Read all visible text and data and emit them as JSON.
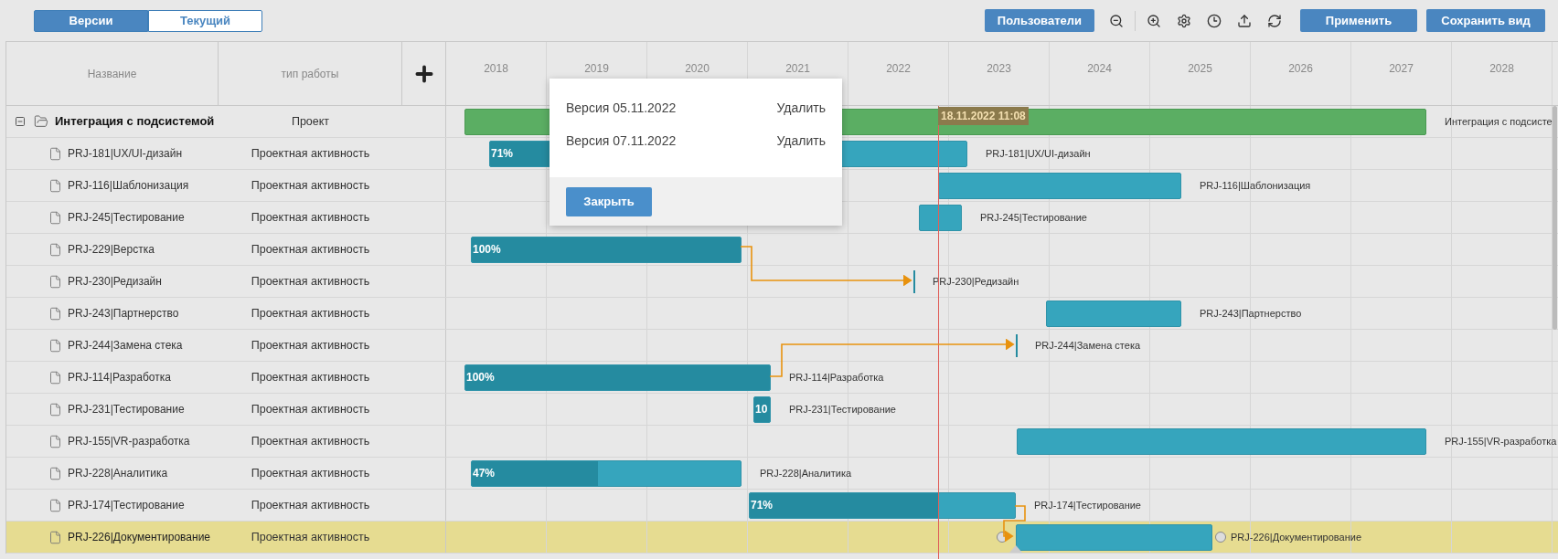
{
  "toolbar": {
    "view_toggle": [
      {
        "label": "Версии",
        "selected": true
      },
      {
        "label": "Текущий",
        "selected": false
      }
    ],
    "users_button": "Пользователи",
    "apply_button": "Применить",
    "save_view_button": "Сохранить вид"
  },
  "table": {
    "columns": [
      "Название",
      "тип работы"
    ],
    "rows": [
      {
        "kind": "project",
        "name": "Интеграция с подсистемой",
        "type": "Проект",
        "expanded": true,
        "selected": false,
        "bar": {
          "kind": "project",
          "label": "Интеграция с подсисте"
        }
      },
      {
        "kind": "task",
        "name": "PRJ-181|UX/UI-дизайн",
        "type": "Проектная активность",
        "selected": false,
        "bar": {
          "kind": "task",
          "level": 0.71,
          "progress": "71%",
          "label": "PRJ-181|UX/UI-дизайн"
        }
      },
      {
        "kind": "task",
        "name": "PRJ-116|Шаблонизация",
        "type": "Проектная активность",
        "selected": false,
        "bar": {
          "kind": "task",
          "label": "PRJ-116|Шаблонизация"
        }
      },
      {
        "kind": "task",
        "name": "PRJ-245|Тестирование",
        "type": "Проектная активность",
        "selected": false,
        "bar": {
          "kind": "task",
          "label": "PRJ-245|Тестирование"
        }
      },
      {
        "kind": "task",
        "name": "PRJ-229|Верстка",
        "type": "Проектная активность",
        "selected": false,
        "bar": {
          "kind": "task",
          "level": 1,
          "progress": "100%"
        }
      },
      {
        "kind": "task",
        "name": "PRJ-230|Редизайн",
        "type": "Проектная активность",
        "selected": false,
        "bar": {
          "kind": "milestone",
          "label": "PRJ-230|Редизайн"
        }
      },
      {
        "kind": "task",
        "name": "PRJ-243|Партнерство",
        "type": "Проектная активность",
        "selected": false,
        "bar": {
          "kind": "task",
          "label": "PRJ-243|Партнерство"
        }
      },
      {
        "kind": "task",
        "name": "PRJ-244|Замена стека",
        "type": "Проектная активность",
        "selected": false,
        "bar": {
          "kind": "milestone",
          "label": "PRJ-244|Замена стека"
        }
      },
      {
        "kind": "task",
        "name": "PRJ-114|Разработка",
        "type": "Проектная активность",
        "selected": false,
        "bar": {
          "kind": "task",
          "level": 1,
          "progress": "100%",
          "label": "PRJ-114|Разработка"
        }
      },
      {
        "kind": "task",
        "name": "PRJ-231|Тестирование",
        "type": "Проектная активность",
        "selected": false,
        "bar": {
          "kind": "task",
          "level": 1,
          "progress": "10",
          "label": "PRJ-231|Тестирование"
        }
      },
      {
        "kind": "task",
        "name": "PRJ-155|VR-разработка",
        "type": "Проектная активность",
        "selected": false,
        "bar": {
          "kind": "task",
          "label": "PRJ-155|VR-разработка"
        }
      },
      {
        "kind": "task",
        "name": "PRJ-228|Аналитика",
        "type": "Проектная активность",
        "selected": false,
        "bar": {
          "kind": "task",
          "level": 0.47,
          "progress": "47%",
          "label": "PRJ-228|Аналитика"
        }
      },
      {
        "kind": "task",
        "name": "PRJ-174|Тестирование",
        "type": "Проектная активность",
        "selected": false,
        "bar": {
          "kind": "task",
          "level": 0.71,
          "progress": "71%",
          "label": "PRJ-174|Тестирование"
        }
      },
      {
        "kind": "task",
        "name": "PRJ-226|Документирование",
        "type": "Проектная активность",
        "selected": true,
        "bar": {
          "kind": "task",
          "label": "PRJ-226|Документирование"
        }
      }
    ]
  },
  "timeline": {
    "years": [
      "2018",
      "2019",
      "2020",
      "2021",
      "2022",
      "2023",
      "2024",
      "2025",
      "2026",
      "2027",
      "2028"
    ],
    "today_marker": "18.11.2022 11:08"
  },
  "versions_dialog": {
    "versions": [
      {
        "label": "Версия 05.11.2022",
        "action": "Удалить"
      },
      {
        "label": "Версия 07.11.2022",
        "action": "Удалить"
      }
    ],
    "close_button": "Закрыть"
  }
}
